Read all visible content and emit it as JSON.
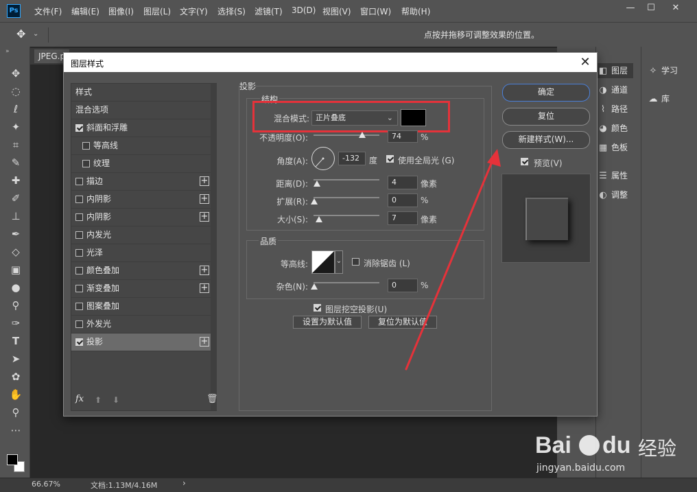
{
  "app": {
    "logo": "Ps",
    "menu": [
      "文件(F)",
      "编辑(E)",
      "图像(I)",
      "图层(L)",
      "文字(Y)",
      "选择(S)",
      "滤镜(T)",
      "3D(D)",
      "视图(V)",
      "窗口(W)",
      "帮助(H)"
    ],
    "window_buttons": [
      "—",
      "☐",
      "✕"
    ]
  },
  "options_bar": {
    "tool_glyph": "✥",
    "hint": "点按并拖移可调整效果的位置。"
  },
  "document": {
    "tab_label": "JPEG.p"
  },
  "status_bar": {
    "zoom": "66.67%",
    "doc_info": "文档:1.13M/4.16M",
    "arrow": "›"
  },
  "panels": {
    "col1": [
      {
        "icon": "layers-icon",
        "glyph": "◧",
        "label": "图层"
      },
      {
        "icon": "channels-icon",
        "glyph": "◑",
        "label": "通道"
      },
      {
        "icon": "paths-icon",
        "glyph": "⌇",
        "label": "路径"
      },
      {
        "icon": "color-icon",
        "glyph": "◕",
        "label": "颜色"
      },
      {
        "icon": "swatches-icon",
        "glyph": "▦",
        "label": "色板"
      },
      {
        "icon": "properties-icon",
        "glyph": "☰",
        "label": "属性"
      },
      {
        "icon": "adjustments-icon",
        "glyph": "◐",
        "label": "调整"
      }
    ],
    "col2": [
      {
        "icon": "learn-icon",
        "glyph": "✧",
        "label": "学习"
      },
      {
        "icon": "libraries-icon",
        "glyph": "☁",
        "label": "库"
      }
    ]
  },
  "dialog": {
    "title": "图层样式",
    "close": "✕",
    "style_list": [
      {
        "label": "样式",
        "checkbox": false,
        "checked": false,
        "plus": false,
        "indent": 0,
        "selected": false
      },
      {
        "label": "混合选项",
        "checkbox": false,
        "checked": false,
        "plus": false,
        "indent": 0,
        "selected": false
      },
      {
        "label": "斜面和浮雕",
        "checkbox": true,
        "checked": true,
        "plus": false,
        "indent": 0,
        "selected": false
      },
      {
        "label": "等高线",
        "checkbox": true,
        "checked": false,
        "plus": false,
        "indent": 1,
        "selected": false
      },
      {
        "label": "纹理",
        "checkbox": true,
        "checked": false,
        "plus": false,
        "indent": 1,
        "selected": false
      },
      {
        "label": "描边",
        "checkbox": true,
        "checked": false,
        "plus": true,
        "indent": 0,
        "selected": false
      },
      {
        "label": "内阴影",
        "checkbox": true,
        "checked": false,
        "plus": true,
        "indent": 0,
        "selected": false
      },
      {
        "label": "内阴影",
        "checkbox": true,
        "checked": false,
        "plus": true,
        "indent": 0,
        "selected": false
      },
      {
        "label": "内发光",
        "checkbox": true,
        "checked": false,
        "plus": false,
        "indent": 0,
        "selected": false
      },
      {
        "label": "光泽",
        "checkbox": true,
        "checked": false,
        "plus": false,
        "indent": 0,
        "selected": false
      },
      {
        "label": "颜色叠加",
        "checkbox": true,
        "checked": false,
        "plus": true,
        "indent": 0,
        "selected": false
      },
      {
        "label": "渐变叠加",
        "checkbox": true,
        "checked": false,
        "plus": true,
        "indent": 0,
        "selected": false
      },
      {
        "label": "图案叠加",
        "checkbox": true,
        "checked": false,
        "plus": false,
        "indent": 0,
        "selected": false
      },
      {
        "label": "外发光",
        "checkbox": true,
        "checked": false,
        "plus": false,
        "indent": 0,
        "selected": false
      },
      {
        "label": "投影",
        "checkbox": true,
        "checked": true,
        "plus": true,
        "indent": 0,
        "selected": true
      }
    ],
    "list_footer": {
      "fx": "fx",
      "up": "⬆",
      "down": "⬇",
      "trash": "🗑"
    },
    "drop_shadow": {
      "section_title": "投影",
      "structure_title": "结构",
      "blend_mode_label": "混合模式:",
      "blend_mode_value": "正片叠底",
      "shadow_color": "#000000",
      "opacity_label": "不透明度(O):",
      "opacity_value": "74",
      "opacity_unit": "%",
      "opacity_fraction": 0.74,
      "angle_label": "角度(A):",
      "angle_value": "-132",
      "angle_unit": "度",
      "global_light_label": "使用全局光 (G)",
      "global_light_checked": true,
      "distance_label": "距离(D):",
      "distance_value": "4",
      "distance_unit": "像素",
      "spread_label": "扩展(R):",
      "spread_value": "0",
      "spread_unit": "%",
      "size_label": "大小(S):",
      "size_value": "7",
      "size_unit": "像素",
      "quality_title": "品质",
      "contour_label": "等高线:",
      "anti_alias_label": "消除锯齿 (L)",
      "anti_alias_checked": false,
      "noise_label": "杂色(N):",
      "noise_value": "0",
      "noise_unit": "%",
      "knockout_label": "图层挖空投影(U)",
      "knockout_checked": true,
      "make_default_label": "设置为默认值",
      "reset_default_label": "复位为默认值"
    },
    "buttons": {
      "ok": "确定",
      "reset": "复位",
      "new_style": "新建样式(W)...",
      "preview_label": "预览(V)",
      "preview_checked": true
    }
  },
  "watermark": {
    "brand": "Bai",
    "brand2": "du",
    "cn": "经验",
    "url": "jingyan.baidu.com"
  },
  "colors": {
    "annotation_red": "#e5323a",
    "ps_blue": "#31a8ff"
  }
}
